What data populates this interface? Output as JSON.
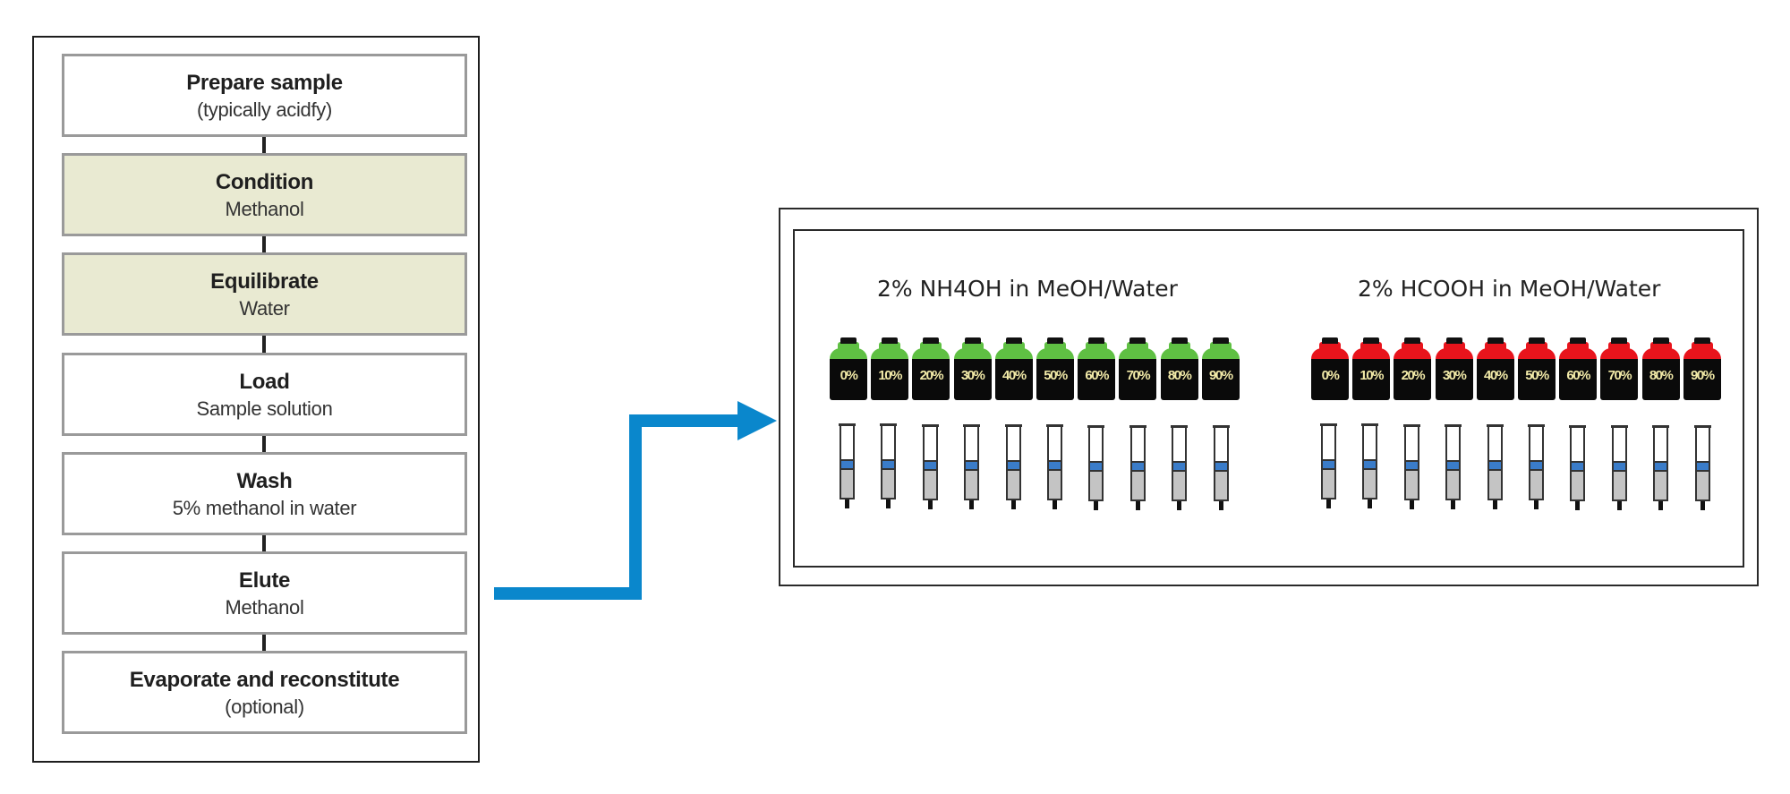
{
  "workflow": {
    "steps": [
      {
        "title": "Prepare sample",
        "detail": "(typically acidfy)",
        "highlighted": false
      },
      {
        "title": "Condition",
        "detail": "Methanol",
        "highlighted": true
      },
      {
        "title": "Equilibrate",
        "detail": "Water",
        "highlighted": true
      },
      {
        "title": "Load",
        "detail": "Sample solution",
        "highlighted": false
      },
      {
        "title": "Wash",
        "detail": "5% methanol in water",
        "highlighted": false
      },
      {
        "title": "Elute",
        "detail": "Methanol",
        "highlighted": false
      },
      {
        "title": "Evaporate and reconstitute",
        "detail": "(optional)",
        "highlighted": false
      }
    ]
  },
  "arrow": {
    "color": "#0a87cc",
    "direction": "right"
  },
  "elution_panel": {
    "groups": [
      {
        "title": "2% NH4OH in MeOH/Water",
        "cap_color": "#5fc043",
        "labels": [
          "0%",
          "10%",
          "20%",
          "30%",
          "40%",
          "50%",
          "60%",
          "70%",
          "80%",
          "90%"
        ]
      },
      {
        "title": "2% HCOOH in MeOH/Water",
        "cap_color": "#e8141c",
        "labels": [
          "0%",
          "10%",
          "20%",
          "30%",
          "40%",
          "50%",
          "60%",
          "70%",
          "80%",
          "90%"
        ]
      }
    ],
    "syringe_band_color": "#3a7cc9",
    "syringe_fill_color": "#c4c4c4",
    "label_color": "#f2eaa8"
  }
}
